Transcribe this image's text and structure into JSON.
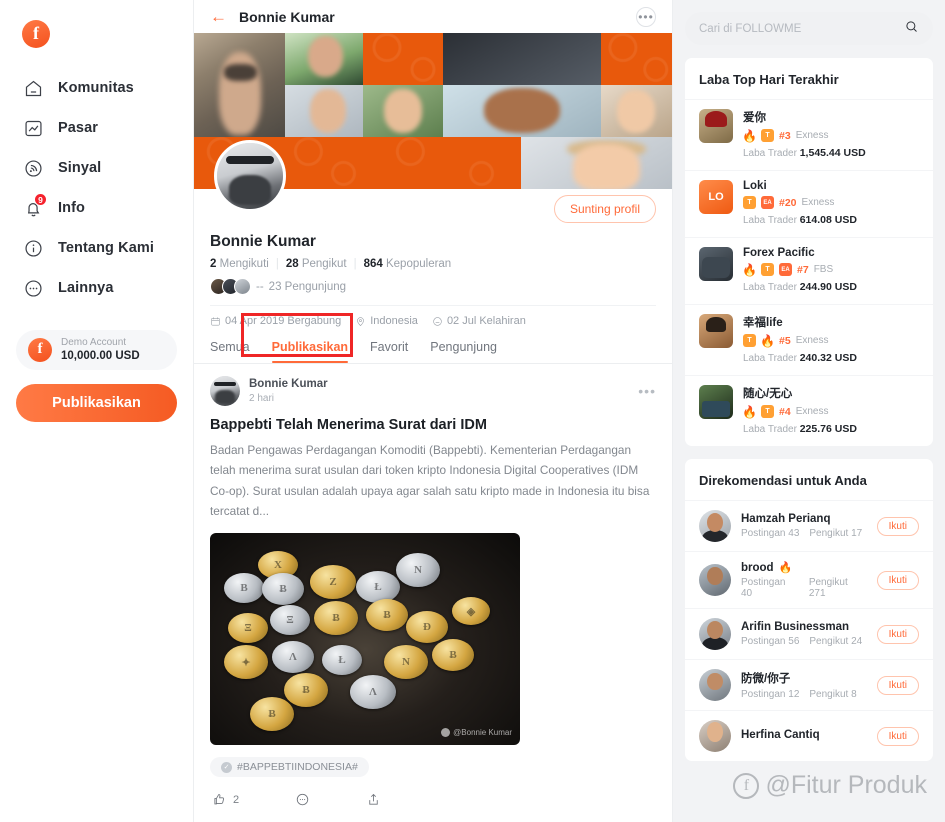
{
  "sidebar": {
    "logo": "followme-logo",
    "items": [
      {
        "label": "Komunitas",
        "icon": "home-icon"
      },
      {
        "label": "Pasar",
        "icon": "chart-icon"
      },
      {
        "label": "Sinyal",
        "icon": "signal-icon"
      },
      {
        "label": "Info",
        "icon": "bell-icon",
        "badge": "9"
      },
      {
        "label": "Tentang Kami",
        "icon": "info-circle-icon"
      },
      {
        "label": "Lainnya",
        "icon": "dots-circle-icon"
      }
    ],
    "demo_account": {
      "label": "Demo Account",
      "value": "10,000.00 USD"
    },
    "publish_button": "Publikasikan"
  },
  "center": {
    "topbar": {
      "back": "←",
      "title": "Bonnie Kumar",
      "more": "•••"
    },
    "edit_button": "Sunting profil",
    "profile": {
      "name": "Bonnie Kumar",
      "stats": [
        {
          "value": "2",
          "label": "Mengikuti"
        },
        {
          "value": "28",
          "label": "Pengikut"
        },
        {
          "value": "864",
          "label": "Kepopuleran"
        }
      ],
      "visitors_dash": "--",
      "visitors": "23 Pengunjung",
      "meta": [
        {
          "icon": "calendar-icon",
          "text": "04 Apr 2019 Bergabung"
        },
        {
          "icon": "location-icon",
          "text": "Indonesia"
        },
        {
          "icon": "cake-icon",
          "text": "02 Jul Kelahiran"
        }
      ]
    },
    "tabs": [
      {
        "label": "Semua",
        "active": false
      },
      {
        "label": "Publikasikan",
        "active": true
      },
      {
        "label": "Favorit",
        "active": false
      },
      {
        "label": "Pengunjung",
        "active": false
      }
    ],
    "post": {
      "author": "Bonnie Kumar",
      "time": "2 hari",
      "more": "•••",
      "title": "Bappebti Telah Menerima Surat dari IDM",
      "body": "Badan Pengawas Perdagangan Komoditi (Bappebti). Kementerian Perdagangan telah menerima surat usulan dari token kripto Indonesia Digital Cooperatives (IDM Co-op). Surat usulan adalah upaya agar salah satu kripto made in Indonesia itu bisa tercatat d...",
      "image_watermark": "@Bonnie Kumar",
      "tag": "#BAPPEBTIINDONESIA#",
      "actions": {
        "like_count": "2",
        "like_icon": "thumbs-up-icon",
        "comment_icon": "comment-icon",
        "share_icon": "share-icon"
      }
    }
  },
  "right": {
    "search_placeholder": "Cari di FOLLOWME",
    "search_icon": "search-icon",
    "top_profit": {
      "title": "Laba Top Hari Terakhir",
      "profit_label": "Laba Trader",
      "traders": [
        {
          "name": "爱你",
          "badges": [
            "fire",
            "T"
          ],
          "rank": "#3",
          "broker": "Exness",
          "profit": "1,545.44 USD",
          "avatar": "tav1"
        },
        {
          "name": "Loki",
          "badges": [
            "T",
            "EA"
          ],
          "rank": "#20",
          "broker": "Exness",
          "profit": "614.08 USD",
          "avatar": "tav2",
          "initials": "LO"
        },
        {
          "name": "Forex Pacific",
          "badges": [
            "fire",
            "T",
            "EA"
          ],
          "rank": "#7",
          "broker": "FBS",
          "profit": "244.90 USD",
          "avatar": "tav3"
        },
        {
          "name": "幸福life",
          "badges": [
            "T",
            "fire"
          ],
          "rank": "#5",
          "broker": "Exness",
          "profit": "240.32 USD",
          "avatar": "tav4"
        },
        {
          "name": "随心/无心",
          "badges": [
            "fire",
            "T"
          ],
          "rank": "#4",
          "broker": "Exness",
          "profit": "225.76 USD",
          "avatar": "tav5"
        }
      ]
    },
    "recommended": {
      "title": "Direkomendasi untuk Anda",
      "follow_label": "Ikuti",
      "users": [
        {
          "name": "Hamzah Perianq",
          "posts": "Postingan 43",
          "followers": "Pengikut 17",
          "avatar": "ra1",
          "fire": false
        },
        {
          "name": "brood",
          "posts": "Postingan 40",
          "followers": "Pengikut 271",
          "avatar": "ra2",
          "fire": true
        },
        {
          "name": "Arifin Businessman",
          "posts": "Postingan 56",
          "followers": "Pengikut 24",
          "avatar": "ra3",
          "fire": false
        },
        {
          "name": "防微/你子",
          "posts": "Postingan 12",
          "followers": "Pengikut 8",
          "avatar": "ra4",
          "fire": false
        },
        {
          "name": "Herfina Cantiq",
          "posts": "",
          "followers": "",
          "avatar": "ra5",
          "fire": false
        }
      ]
    }
  },
  "watermark": {
    "text": "@Fitur Produk",
    "logo": "followme-logo"
  },
  "colors": {
    "accent": "#FF6A39",
    "accent_dark": "#E8590C",
    "highlight": "#EF2626",
    "badge_red": "#F5222D"
  }
}
